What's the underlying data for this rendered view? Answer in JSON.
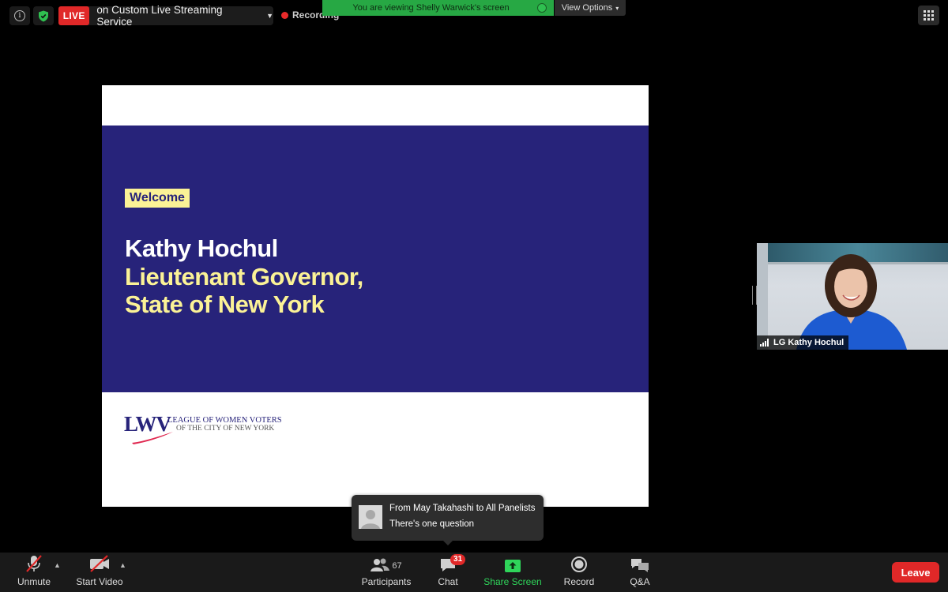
{
  "top_bar": {
    "live_badge": "LIVE",
    "live_status": "on Custom Live Streaming Service",
    "recording_label": "Recording",
    "screen_share_banner": "You are viewing Shelly Warwick's screen",
    "view_options_label": "View Options"
  },
  "slide": {
    "welcome_label": "Welcome",
    "speaker_name": "Kathy Hochul",
    "speaker_title_lines": [
      "Lieutenant Governor,",
      "State of New York"
    ],
    "logo": {
      "letters": "LWV",
      "line1": "LEAGUE OF WOMEN VOTERS",
      "line2": "OF THE CITY OF NEW YORK"
    },
    "colors": {
      "band": "#27237a",
      "highlight": "#fbf296"
    }
  },
  "video": {
    "participant_name": "LG Kathy Hochul"
  },
  "chat_notification": {
    "sender_line": "From May Takahashi to All Panelists",
    "message": "There's one question"
  },
  "toolbar": {
    "unmute_label": "Unmute",
    "start_video_label": "Start Video",
    "participants_label": "Participants",
    "participants_count": "67",
    "chat_label": "Chat",
    "chat_badge": "31",
    "share_screen_label": "Share Screen",
    "record_label": "Record",
    "qa_label": "Q&A",
    "leave_label": "Leave"
  }
}
